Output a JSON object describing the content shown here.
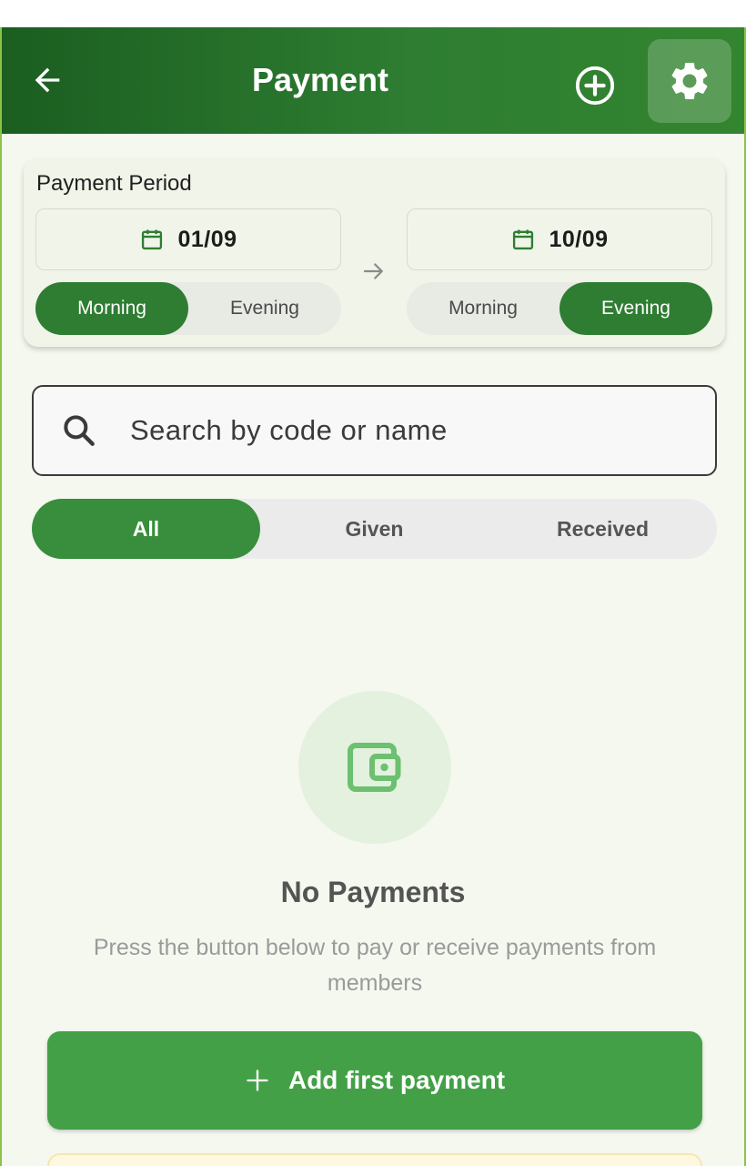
{
  "appbar": {
    "title": "Payment",
    "back_icon": "arrow-left-icon",
    "add_icon": "plus-circle-icon",
    "settings_icon": "gear-icon"
  },
  "period": {
    "label": "Payment Period",
    "from_date": "01/09",
    "to_date": "10/09",
    "from_shift": {
      "options": [
        "Morning",
        "Evening"
      ],
      "selected": "Morning"
    },
    "to_shift": {
      "options": [
        "Morning",
        "Evening"
      ],
      "selected": "Evening"
    }
  },
  "search": {
    "placeholder": "Search by code or name"
  },
  "filter": {
    "options": [
      "All",
      "Given",
      "Received"
    ],
    "selected": "All"
  },
  "empty_state": {
    "icon": "wallet-icon",
    "title": "No Payments",
    "description": "Press the button below to pay or receive payments from members"
  },
  "add_first_button": {
    "label": "Add first payment"
  },
  "colors": {
    "primary": "#2e7d32",
    "primary_light": "#43a047",
    "background": "#f5f8ef",
    "empty_circle": "#e3f1de"
  }
}
